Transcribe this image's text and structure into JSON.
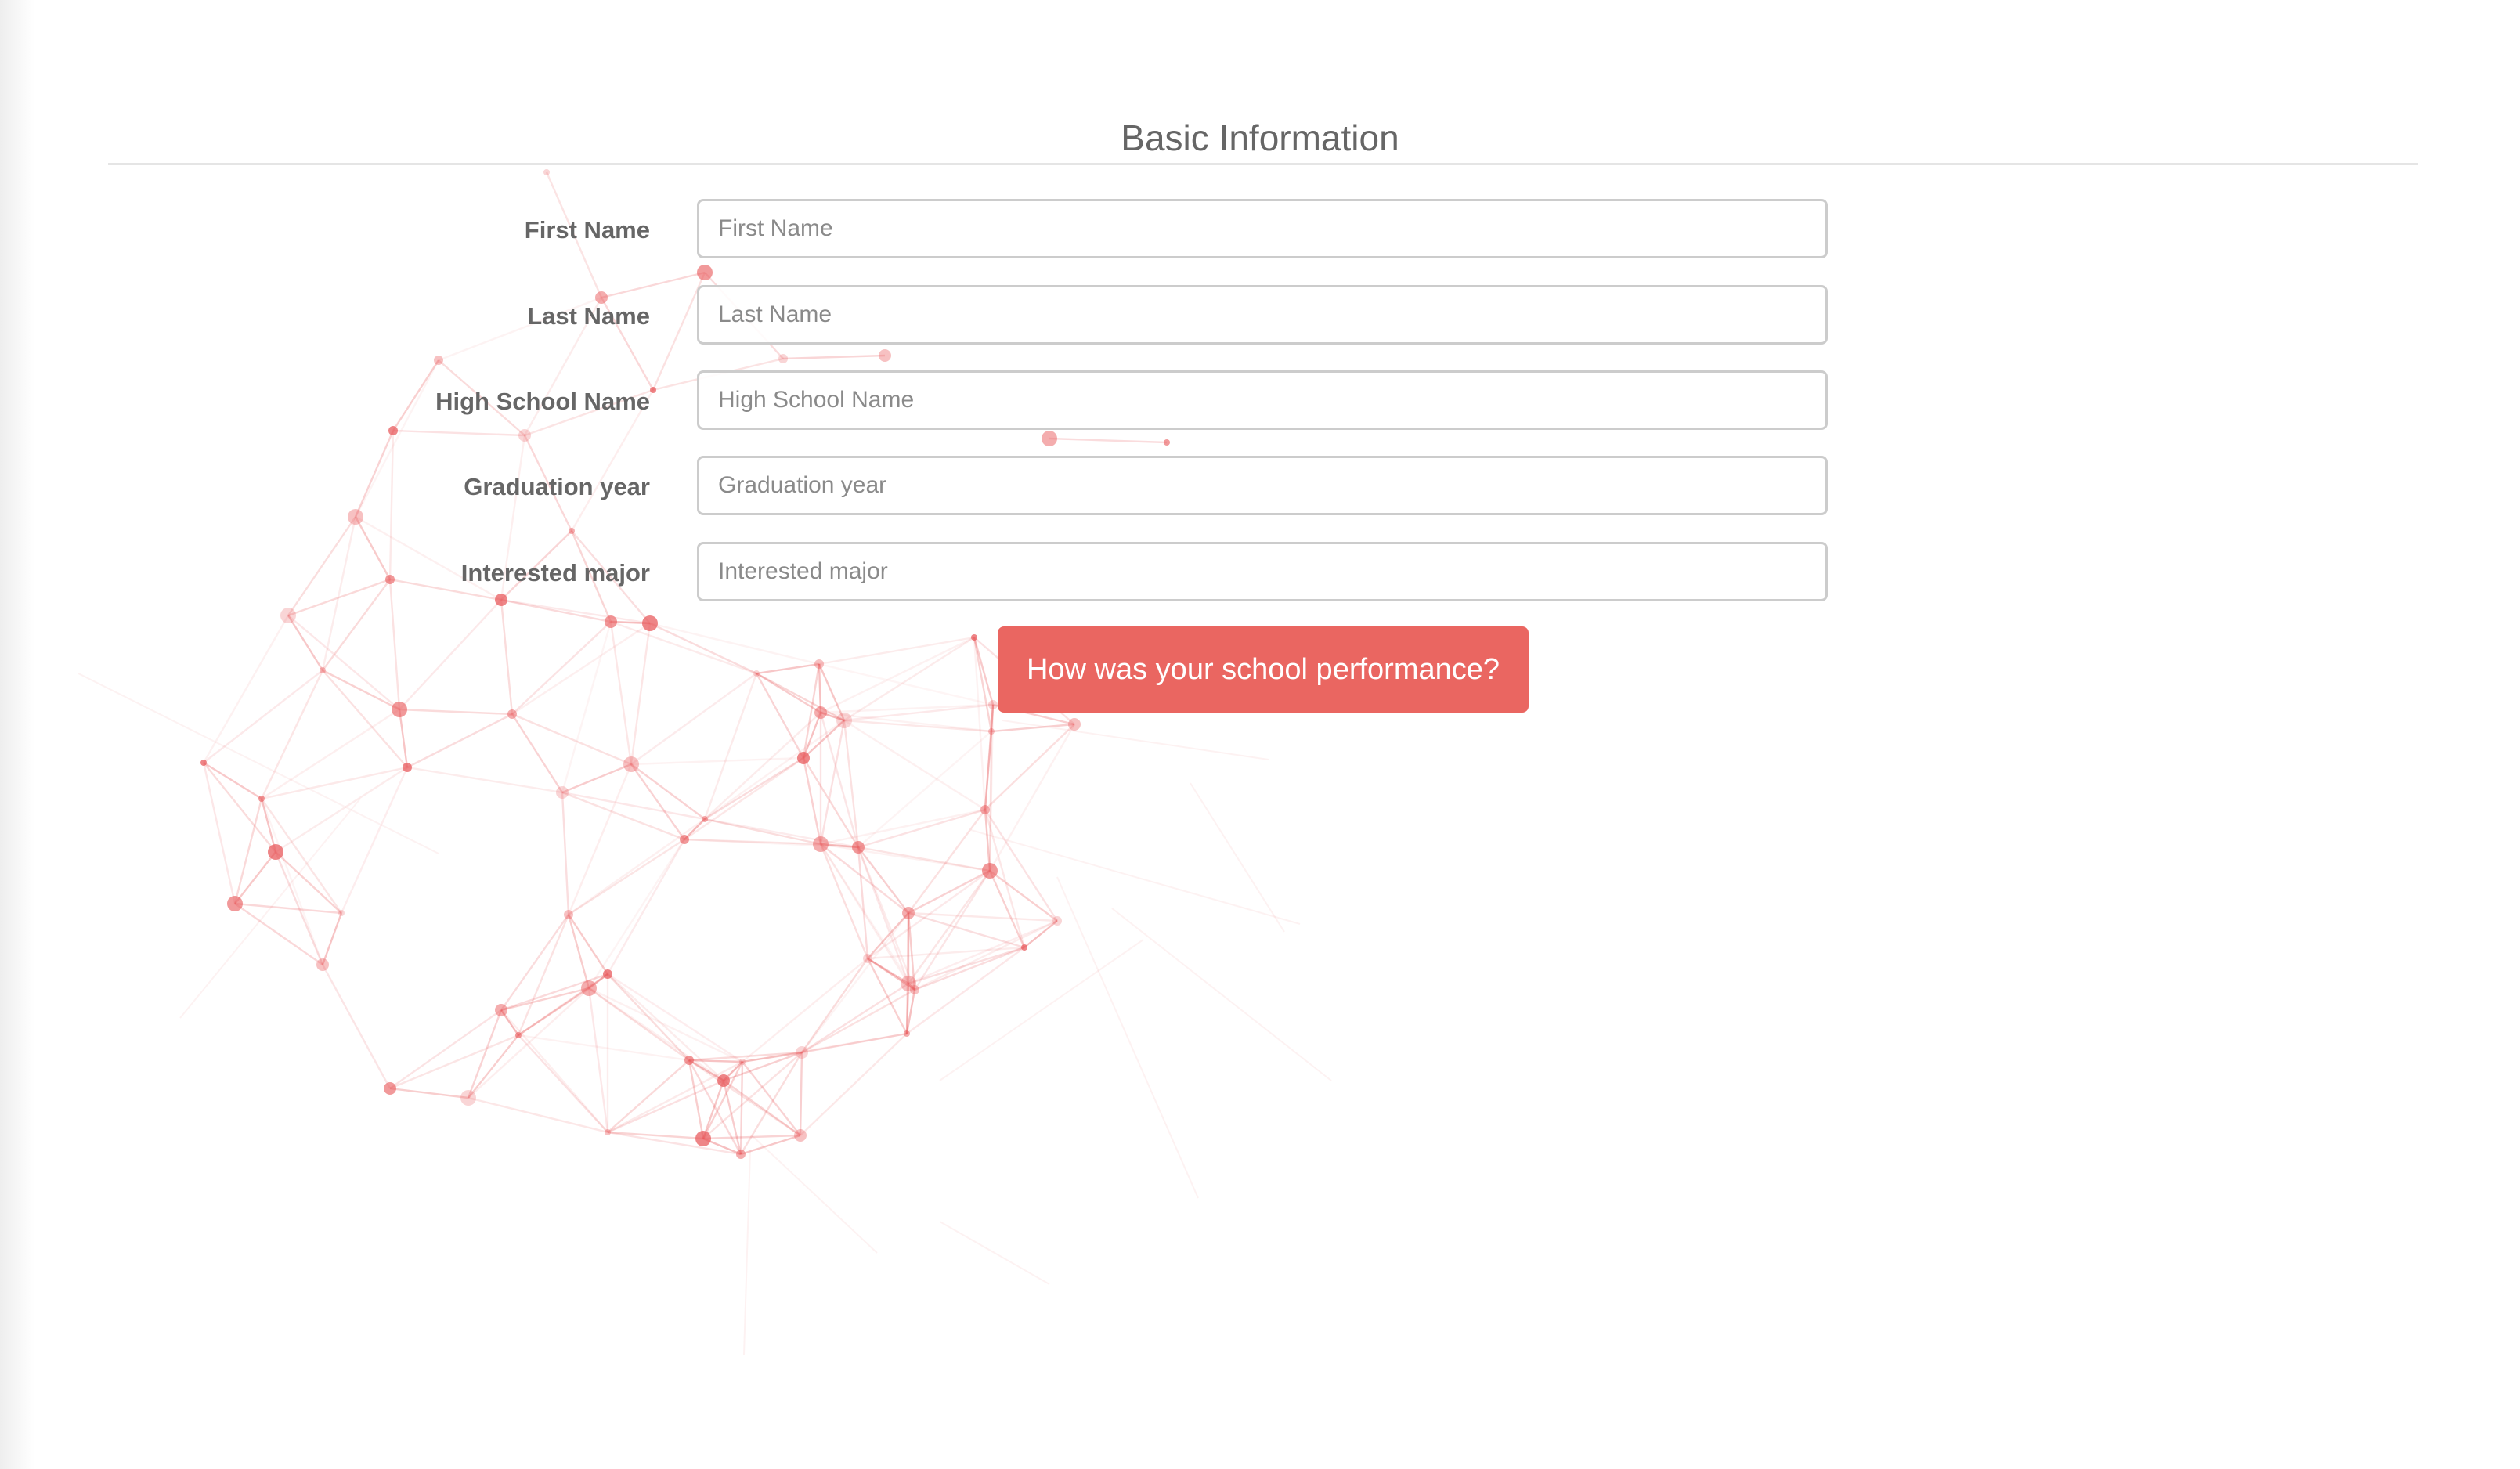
{
  "section": {
    "title": "Basic Information"
  },
  "form": {
    "fields": [
      {
        "label": "First Name",
        "placeholder": "First Name",
        "value": ""
      },
      {
        "label": "Last Name",
        "placeholder": "Last Name",
        "value": ""
      },
      {
        "label": "High School Name",
        "placeholder": "High School Name",
        "value": ""
      },
      {
        "label": "Graduation year",
        "placeholder": "Graduation year",
        "value": ""
      },
      {
        "label": "Interested major",
        "placeholder": "Interested major",
        "value": ""
      }
    ],
    "submit_label": "How was your school performance?"
  },
  "colors": {
    "accent": "#ea6661",
    "network": "#e8585a",
    "label_text": "#666666",
    "input_border": "#cccccc"
  }
}
